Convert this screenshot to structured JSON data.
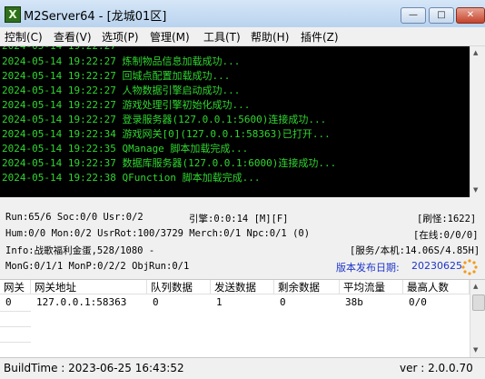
{
  "window": {
    "icon_glyph": "X",
    "title": "M2Server64 - [龙城01区]",
    "minimize_glyph": "—",
    "restore_glyph": "□",
    "close_glyph": "✕"
  },
  "menu": [
    {
      "label": "控制(C)"
    },
    {
      "label": "查看(V)"
    },
    {
      "label": "选项(P)"
    },
    {
      "label": "管理(M)"
    },
    {
      "label": "工具(T)"
    },
    {
      "label": "帮助(H)"
    },
    {
      "label": "插件(Z)"
    }
  ],
  "log": [
    "2024-05-14 19:22:27 炼制物品信息加载成功...",
    "2024-05-14 19:22:27 回城点配置加载成功...",
    "2024-05-14 19:22:27 人物数据引擎启动成功...",
    "2024-05-14 19:22:27 游戏处理引擎初始化成功...",
    "2024-05-14 19:22:27 登录服务器(127.0.0.1:5600)连接成功...",
    "2024-05-14 19:22:34 游戏网关[0](127.0.0.1:58363)已打开...",
    "2024-05-14 19:22:35 QManage 脚本加载完成...",
    "2024-05-14 19:22:37 数据库服务器(127.0.0.1:6000)连接成功...",
    "2024-05-14 19:22:38 QFunction 脚本加载完成..."
  ],
  "status": {
    "run": "Run:65/6 Soc:0/0 Usr:0/2",
    "engine": "引擎:0:0:14 [M][F]",
    "refresh": "[刷怪:1622]",
    "hum": "Hum:0/0 Mon:0/2 UsrRot:100/3729 Merch:0/1 Npc:0/1 (0)",
    "online": "[在线:0/0/0]",
    "info": "Info:战歌福利金蛋,528/1080 -",
    "server": "[服务/本机:14.06S/4.85H]",
    "mong": "MonG:0/1/1 MonP:0/2/2 ObjRun:0/1",
    "release_label": "版本发布日期:",
    "release_date": "20230625"
  },
  "gateway_table": {
    "columns": [
      "网关",
      "网关地址",
      "队列数据",
      "发送数据",
      "剩余数据",
      "平均流量",
      "最高人数"
    ],
    "rows": [
      [
        "0",
        "127.0.0.1:58363",
        "0",
        "1",
        "0",
        "38b",
        "0/0"
      ]
    ]
  },
  "statusbar": {
    "build_time": "BuildTime : 2023-06-25 16:43:52",
    "version": "ver : 2.0.0.70"
  },
  "colors": {
    "console_bg": "#000000",
    "console_text": "#2fd62f",
    "release_text": "#1e35c8"
  }
}
